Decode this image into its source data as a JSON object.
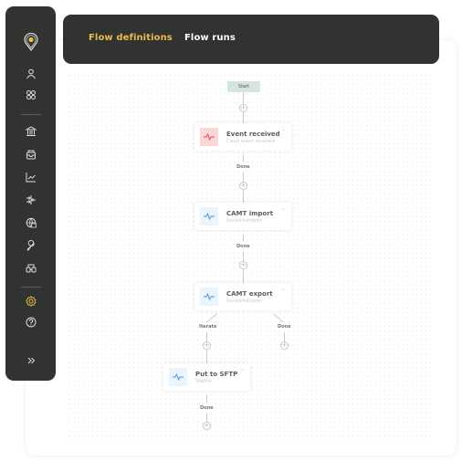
{
  "sidebar": {
    "logo": "pin-logo-icon",
    "items": [
      {
        "name": "user",
        "icon": "user-icon"
      },
      {
        "name": "apps",
        "icon": "apps-icon"
      },
      {
        "name": "bank",
        "icon": "bank-icon"
      },
      {
        "name": "inbox",
        "icon": "inbox-icon"
      },
      {
        "name": "chart",
        "icon": "chart-icon"
      },
      {
        "name": "merge",
        "icon": "merge-arrows-icon"
      },
      {
        "name": "network",
        "icon": "network-icon"
      },
      {
        "name": "tools",
        "icon": "wrench-icon"
      },
      {
        "name": "link",
        "icon": "link-icon"
      },
      {
        "name": "settings",
        "icon": "gear-icon",
        "active": true
      },
      {
        "name": "help",
        "icon": "help-icon"
      },
      {
        "name": "expand",
        "icon": "double-chevron-right-icon"
      }
    ],
    "accent_color": "#e9bd4c"
  },
  "header": {
    "tabs": [
      {
        "label": "Flow definitions",
        "active": true
      },
      {
        "label": "Flow runs",
        "active": false
      }
    ]
  },
  "flow": {
    "start_label": "Start",
    "nodes": [
      {
        "title": "Event received",
        "subtitle": "Cloud event received",
        "icon": "pulse-icon",
        "icon_color": "#e0474c",
        "icon_bg": "#fcd7d7"
      },
      {
        "title": "CAMT import",
        "subtitle": "AccountsImport",
        "icon": "pulse-icon",
        "icon_color": "#4a8fd6",
        "icon_bg": "#eaf4fd"
      },
      {
        "title": "CAMT export",
        "subtitle": "AccountsExport",
        "icon": "pulse-icon",
        "icon_color": "#4a8fd6",
        "icon_bg": "#eaf4fd"
      },
      {
        "title": "Put to SFTP",
        "subtitle": "SftpPut",
        "icon": "pulse-icon",
        "icon_color": "#4a8fd6",
        "icon_bg": "#eaf4fd"
      }
    ],
    "edge_labels": {
      "done1": "Done",
      "done2": "Done",
      "iterate": "Iterate",
      "done3": "Done",
      "done4": "Done"
    },
    "plus_symbol": "+",
    "chevron_symbol": "⌄"
  }
}
